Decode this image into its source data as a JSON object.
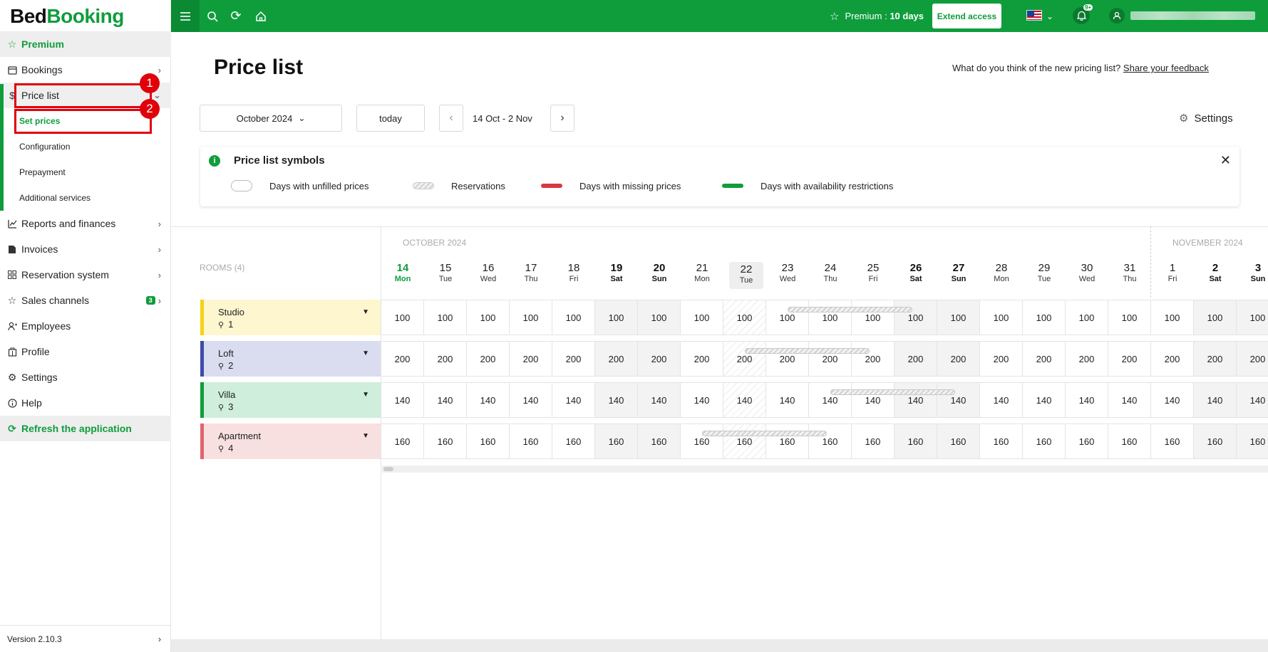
{
  "brand": {
    "part1": "Bed",
    "part2": "Booking"
  },
  "sidebar": {
    "premium": "Premium",
    "bookings": "Bookings",
    "price_list": "Price list",
    "sub": [
      "Set prices",
      "Configuration",
      "Prepayment",
      "Additional services"
    ],
    "reports": "Reports and finances",
    "invoices": "Invoices",
    "reservation_system": "Reservation system",
    "sales_channels": "Sales channels",
    "sales_badge": "3",
    "employees": "Employees",
    "profile": "Profile",
    "settings": "Settings",
    "help": "Help",
    "refresh": "Refresh the application",
    "version": "Version 2.10.3"
  },
  "annotations": [
    "1",
    "2"
  ],
  "topbar": {
    "premium_label": "Premium",
    "premium_sep": " : ",
    "premium_days": "10 days",
    "extend": "Extend access",
    "notif_badge": "9+"
  },
  "page": {
    "title": "Price list",
    "feedback_text": "What do you think of the new pricing list?",
    "feedback_link": "Share your feedback"
  },
  "controls": {
    "month": "October 2024",
    "today": "today",
    "range": "14 Oct - 2 Nov",
    "settings": "Settings"
  },
  "legend": {
    "title": "Price list symbols",
    "items": [
      "Days with unfilled prices",
      "Reservations",
      "Days with missing prices",
      "Days with availability restrictions"
    ],
    "colors": {
      "missing": "#d9373f",
      "restrictions": "#0f9d3c"
    }
  },
  "grid": {
    "rooms_header": "ROOMS (4)",
    "months": [
      "OCTOBER 2024",
      "NOVEMBER 2024"
    ],
    "days": [
      {
        "n": "14",
        "w": "Mon"
      },
      {
        "n": "15",
        "w": "Tue"
      },
      {
        "n": "16",
        "w": "Wed"
      },
      {
        "n": "17",
        "w": "Thu"
      },
      {
        "n": "18",
        "w": "Fri"
      },
      {
        "n": "19",
        "w": "Sat"
      },
      {
        "n": "20",
        "w": "Sun"
      },
      {
        "n": "21",
        "w": "Mon"
      },
      {
        "n": "22",
        "w": "Tue"
      },
      {
        "n": "23",
        "w": "Wed"
      },
      {
        "n": "24",
        "w": "Thu"
      },
      {
        "n": "25",
        "w": "Fri"
      },
      {
        "n": "26",
        "w": "Sat"
      },
      {
        "n": "27",
        "w": "Sun"
      },
      {
        "n": "28",
        "w": "Mon"
      },
      {
        "n": "29",
        "w": "Tue"
      },
      {
        "n": "30",
        "w": "Wed"
      },
      {
        "n": "31",
        "w": "Thu"
      },
      {
        "n": "1",
        "w": "Fri"
      },
      {
        "n": "2",
        "w": "Sat"
      },
      {
        "n": "3",
        "w": "Sun"
      }
    ],
    "rooms": [
      {
        "name": "Studio",
        "people": "1",
        "color": "#f5d117",
        "bg": "#fdf6cf",
        "price": "100",
        "res": [
          9,
          11
        ]
      },
      {
        "name": "Loft",
        "people": "2",
        "color": "#3f4aa8",
        "bg": "#dadcef",
        "price": "200",
        "res": [
          8,
          10
        ]
      },
      {
        "name": "Villa",
        "people": "3",
        "color": "#0f9d3c",
        "bg": "#cfeedb",
        "price": "140",
        "res": [
          10,
          12
        ]
      },
      {
        "name": "Apartment",
        "people": "4",
        "color": "#e0656c",
        "bg": "#f8e0e1",
        "price": "160",
        "res": [
          7,
          9
        ]
      }
    ]
  }
}
